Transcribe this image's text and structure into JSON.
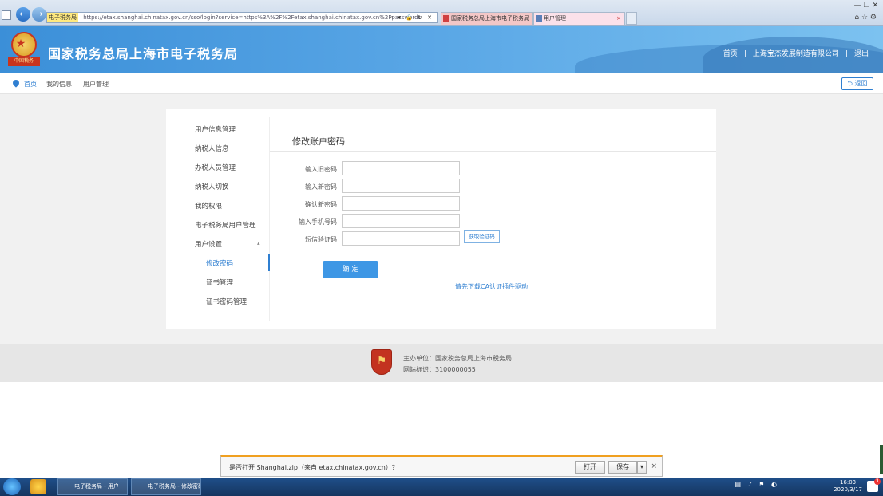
{
  "browser": {
    "address_chip": "电子税务局",
    "address_url": "https://etax.shanghai.chinatax.gov.cn/sso/login?service=https%3A%2F%2Fetax.shanghai.chinatax.gov.cn%2Fpasswords",
    "address_tools": "⌕ ▾ 🔒 ↻ ✕",
    "tabs": [
      {
        "label": "国家税务总局上海市电子税务局"
      },
      {
        "label": "用户管理"
      }
    ],
    "tab_close": "×",
    "window_controls": "— ❐ ✕",
    "right_icons": "⌂ ☆ ⚙"
  },
  "header": {
    "emblem_ribbon": "中国税务",
    "title": "国家税务总局上海市电子税务局",
    "links": [
      "首页",
      "上海宝杰发展制造有限公司",
      "退出"
    ],
    "separator": "|"
  },
  "breadcrumb": {
    "items": [
      "首页",
      "我的信息",
      "用户管理"
    ],
    "back_label": "返回"
  },
  "sidebar": {
    "items": [
      {
        "label": "用户信息管理"
      },
      {
        "label": "纳税人信息"
      },
      {
        "label": "办税人员管理"
      },
      {
        "label": "纳税人切换"
      },
      {
        "label": "我的权限"
      },
      {
        "label": "电子税务局用户管理"
      },
      {
        "label": "用户设置"
      },
      {
        "label": "修改密码",
        "sub": true
      },
      {
        "label": "证书管理",
        "sub": true
      },
      {
        "label": "证书密码管理",
        "sub": true
      }
    ],
    "caret": "▴"
  },
  "form": {
    "title": "修改账户密码",
    "fields": [
      {
        "label": "输入旧密码",
        "placeholder": ""
      },
      {
        "label": "输入新密码",
        "placeholder": ""
      },
      {
        "label": "确认新密码",
        "placeholder": ""
      },
      {
        "label": "输入手机号码",
        "placeholder": ""
      },
      {
        "label": "短信验证码",
        "placeholder": ""
      }
    ],
    "code_button": "获取验证码",
    "submit": "确 定",
    "download_link": "请先下载CA认证插件驱动"
  },
  "footer": {
    "line1": "主办单位：国家税务总局上海市税务局",
    "line2": "网站标识：3100000055"
  },
  "download_bar": {
    "message": "是否打开 Shanghai.zip（来自 etax.chinatax.gov.cn）？",
    "open": "打开",
    "save": "保存",
    "arrow": "▾",
    "close": "×"
  },
  "taskbar": {
    "tasks": [
      "电子税务局 - 用户",
      "电子税务局 - 修改密码"
    ],
    "tray": "▤ ♪ ⚑ ◐",
    "clock_time": "16:03",
    "clock_date": "2020/3/17",
    "notif_count": "1"
  },
  "colors": {
    "accent": "#2f7fd1",
    "banner": "#3b8fd8",
    "submit": "#3e97e5",
    "download_bar_border": "#f0a020"
  }
}
